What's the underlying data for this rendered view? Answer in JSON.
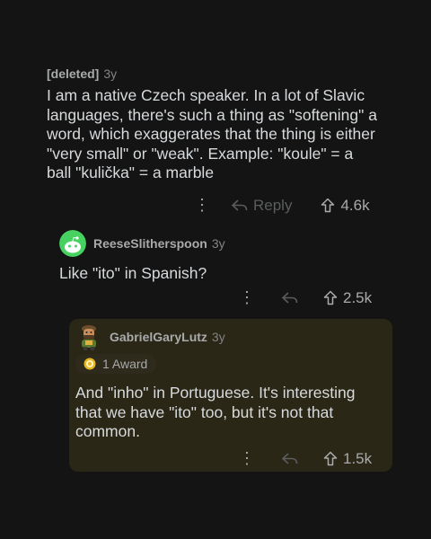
{
  "comments": [
    {
      "author": "[deleted]",
      "age": "3y",
      "text": "I am a native Czech speaker. In a lot of Slavic languages, there's such a thing as \"softening\" a word, which exaggerates that the thing is either \"very small\" or \"weak\". Example: \"koule\" = a ball \"kulička\" = a marble",
      "reply_label": "Reply",
      "votes": "4.6k"
    },
    {
      "author": "ReeseSlitherspoon",
      "age": "3y",
      "text": "Like \"ito\" in Spanish?",
      "votes": "2.5k"
    },
    {
      "author": "GabrielGaryLutz",
      "age": "3y",
      "award": "1 Award",
      "text": "And \"inho\" in Portuguese. It's interesting that we have \"ito\" too, but it's not that common.",
      "votes": "1.5k"
    }
  ],
  "colors": {
    "background": "#141414",
    "highlight": "#2b2717",
    "text": "#d7dadc",
    "muted": "#818384"
  }
}
